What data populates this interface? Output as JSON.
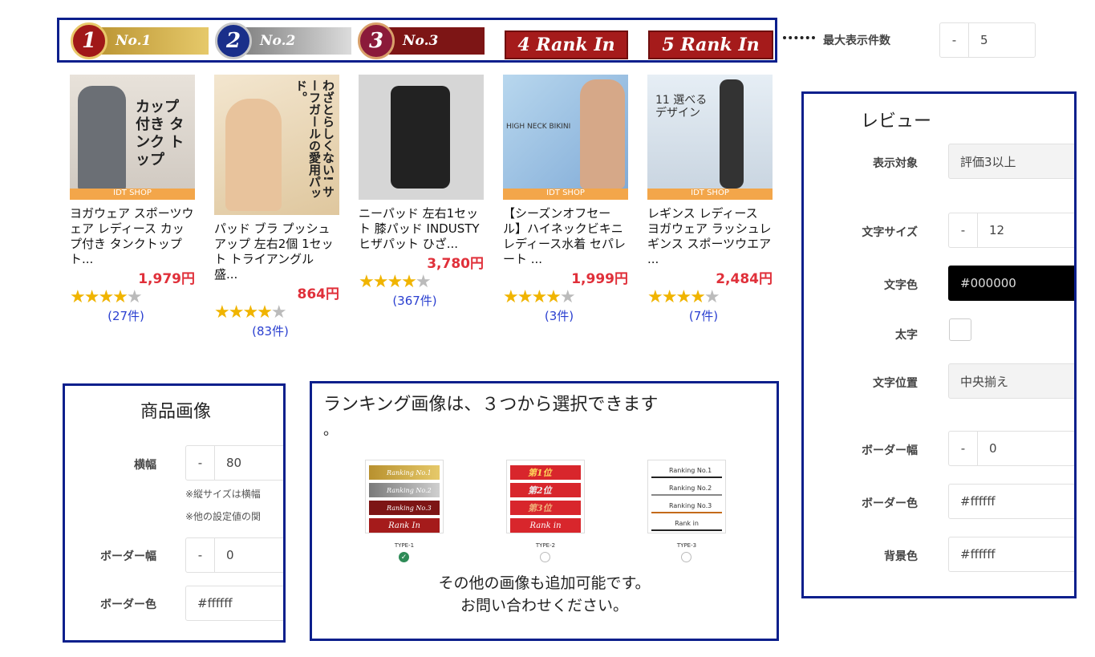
{
  "ranking_bar": {
    "items": [
      {
        "num": "1",
        "label": "No.1",
        "color": "#c9a13a"
      },
      {
        "num": "2",
        "label": "No.2",
        "color": "#9a9a9a"
      },
      {
        "num": "3",
        "label": "No.3",
        "color": "#8b1a1a"
      },
      {
        "num": "4",
        "label": "Rank In"
      },
      {
        "num": "5",
        "label": "Rank In"
      }
    ]
  },
  "max_display": {
    "label": "最大表示件数",
    "minus": "-",
    "value": "5"
  },
  "products": [
    {
      "title": "ヨガウェア スポーツウェア レディース カップ付き タンクトップ ト...",
      "price": "1,979円",
      "rating": 4,
      "count": "(27件)",
      "img_text": "カップ付き タンク トップ",
      "shop": "IDT SHOP"
    },
    {
      "title": "パッド ブラ プッシュアップ 左右2個 1セット トライアングル 盛...",
      "price": "864円",
      "rating": 4,
      "count": "(83件)",
      "img_text": "わざとらしくない! サーフガールの愛用パッド。",
      "shop": ""
    },
    {
      "title": "ニーパッド 左右1セット 膝パッド INDUSTY ヒザパット ひざ...",
      "price": "3,780円",
      "rating": 4.5,
      "count": "(367件)",
      "img_text": "",
      "shop": ""
    },
    {
      "title": "【シーズンオフセール】ハイネックビキニレディース水着 セパレート ...",
      "price": "1,999円",
      "rating": 4,
      "count": "(3件)",
      "img_text": "HIGH NECK BIKINI",
      "shop": "IDT SHOP"
    },
    {
      "title": "レギンス レディース ヨガウェア ラッシュレギンス スポーツウエア ...",
      "price": "2,484円",
      "rating": 4.5,
      "count": "(7件)",
      "img_text": "11 選べる デザイン",
      "shop": "IDT SHOP"
    }
  ],
  "review_panel": {
    "title": "レビュー",
    "rows": [
      {
        "label": "表示対象",
        "value": "評価3以上"
      },
      {
        "label": "文字サイズ",
        "minus": "-",
        "value": "12"
      },
      {
        "label": "文字色",
        "value": "#000000"
      },
      {
        "label": "太字",
        "value": ""
      },
      {
        "label": "文字位置",
        "value": "中央揃え"
      },
      {
        "label": "ボーダー幅",
        "minus": "-",
        "value": "0"
      },
      {
        "label": "ボーダー色",
        "value": "#ffffff"
      },
      {
        "label": "背景色",
        "value": "#ffffff"
      }
    ]
  },
  "image_panel": {
    "title": "商品画像",
    "width_label": "横幅",
    "width_minus": "-",
    "width_value": "80",
    "note1": "※縦サイズは横幅",
    "note2": "※他の設定値の関",
    "border_width_label": "ボーダー幅",
    "border_width_minus": "-",
    "border_width_value": "0",
    "border_color_label": "ボーダー色",
    "border_color_value": "#ffffff"
  },
  "type_panel": {
    "title_line1": "ランキング画像は、３つから選択できます",
    "title_line2": "。",
    "types": [
      {
        "label": "TYPE-1",
        "selected": true,
        "rows": [
          "Ranking No.1",
          "Ranking No.2",
          "Ranking No.3",
          "Rank In"
        ]
      },
      {
        "label": "TYPE-2",
        "selected": false,
        "rows": [
          "第1位",
          "第2位",
          "第3位",
          "Rank in"
        ]
      },
      {
        "label": "TYPE-3",
        "selected": false,
        "rows": [
          "Ranking No.1",
          "Ranking No.2",
          "Ranking No.3",
          "Rank in"
        ]
      }
    ],
    "footer_line1": "その他の画像も追加可能です。",
    "footer_line2": "お問い合わせください。"
  }
}
